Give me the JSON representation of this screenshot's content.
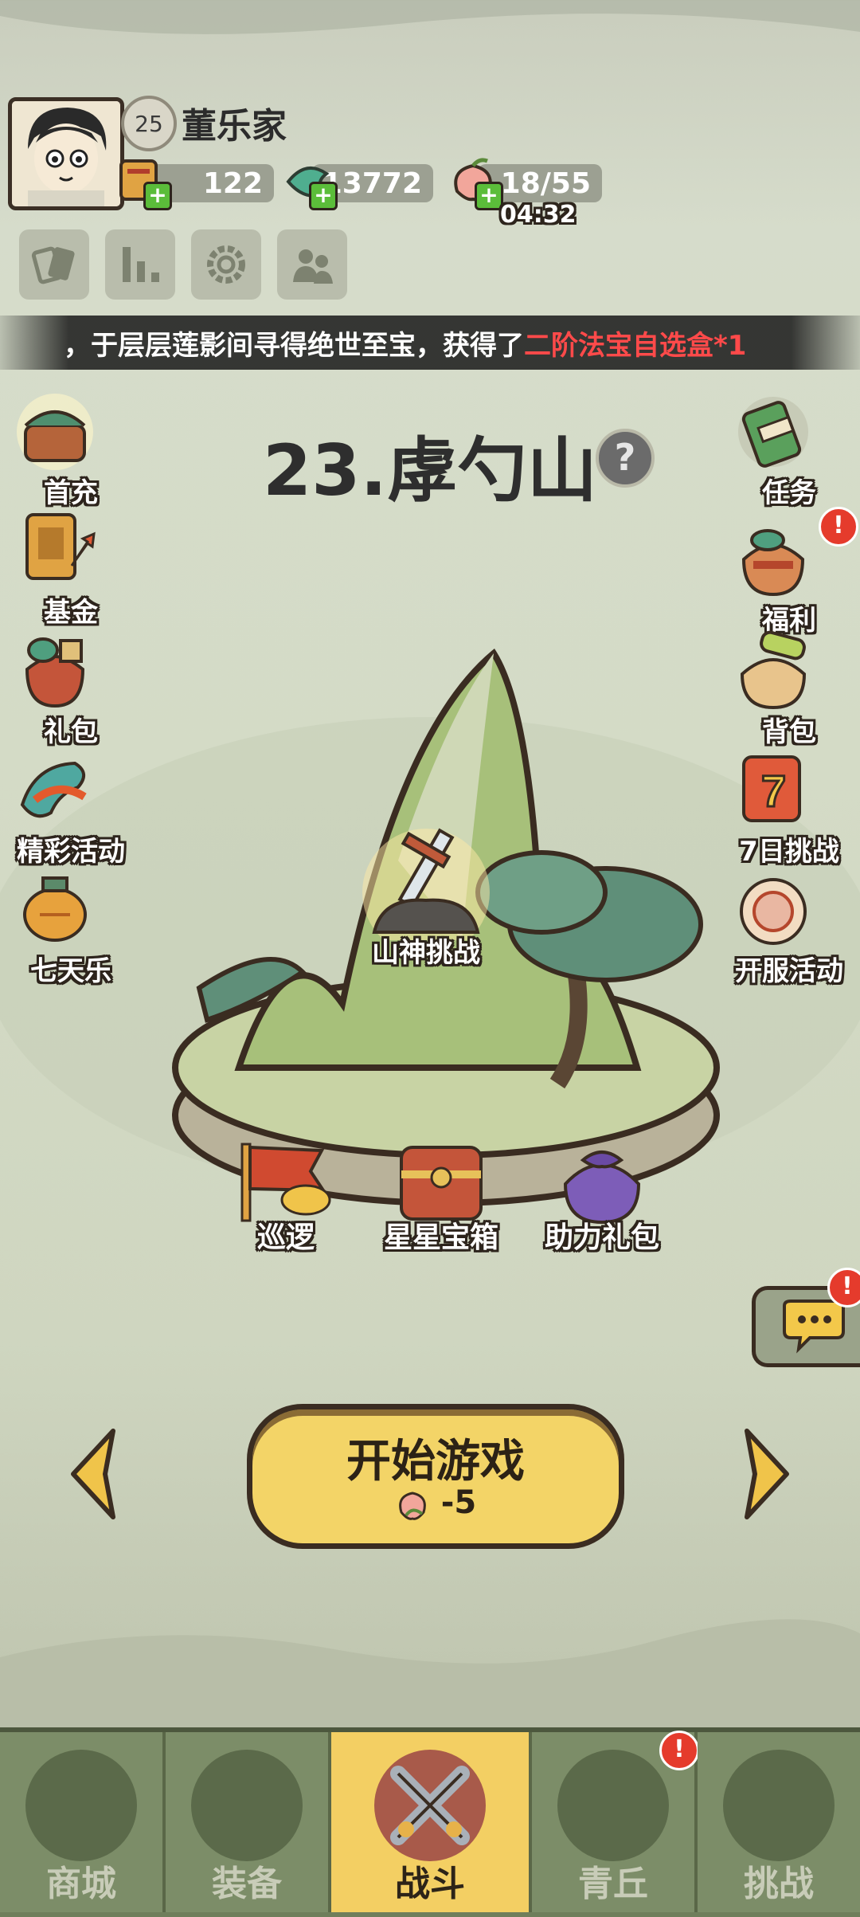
{
  "player": {
    "name": "董乐家",
    "level": "25"
  },
  "resources": [
    {
      "name": "coupon",
      "value": "122"
    },
    {
      "name": "jade",
      "value": "13772"
    },
    {
      "name": "peach",
      "value": "18/55"
    }
  ],
  "stamina_timer": "04:32",
  "marquee": {
    "text": "，于层层莲影间寻得绝世至宝，获得了 ",
    "highlight": "二阶法宝自选盒*1"
  },
  "stage": {
    "title": "23.虖勺山",
    "help": "?"
  },
  "left_menu": [
    {
      "label": "首充"
    },
    {
      "label": "基金"
    },
    {
      "label": "礼包"
    },
    {
      "label": "精彩活动"
    },
    {
      "label": "七天乐"
    }
  ],
  "right_menu": [
    {
      "label": "任务"
    },
    {
      "label": "福利"
    },
    {
      "label": "背包"
    },
    {
      "label": "7日挑战"
    },
    {
      "label": "开服活动"
    }
  ],
  "boss_label": "山神挑战",
  "bottom_items": [
    {
      "label": "巡逻"
    },
    {
      "label": "星星宝箱"
    },
    {
      "label": "助力礼包"
    }
  ],
  "badge": "!",
  "start": {
    "label": "开始游戏",
    "cost": "-5"
  },
  "nav": [
    {
      "label": "商城"
    },
    {
      "label": "装备"
    },
    {
      "label": "战斗"
    },
    {
      "label": "青丘"
    },
    {
      "label": "挑战"
    }
  ]
}
